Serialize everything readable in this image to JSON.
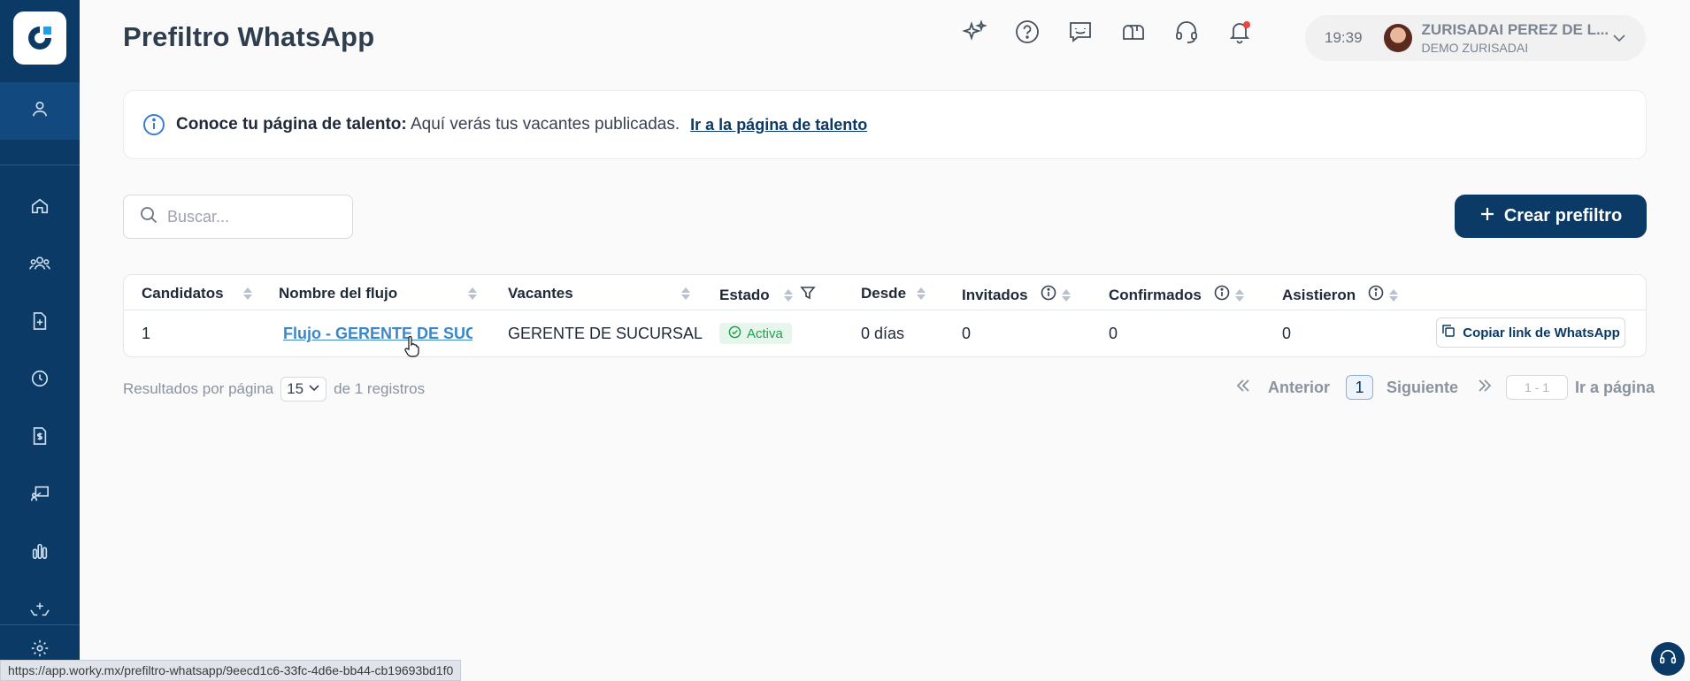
{
  "header": {
    "title": "Prefiltro WhatsApp",
    "icons": [
      "sparkles-icon",
      "help-icon",
      "feedback-icon",
      "mailbox-icon",
      "support-headset-icon",
      "bell-icon"
    ],
    "time": "19:39",
    "user_name": "ZURISADAI PEREZ DE L...",
    "user_org": "DEMO ZURISADAI"
  },
  "sidebar": {
    "items": [
      "user-icon",
      "home-icon",
      "users-icon",
      "add-document-icon",
      "history-icon",
      "invoice-icon",
      "presentation-icon",
      "analytics-icon",
      "hand-care-icon",
      "gear-icon"
    ]
  },
  "banner": {
    "title": "Conoce tu página de talento:",
    "text": " Aquí verás tus vacantes publicadas.",
    "link": "Ir a la página de talento"
  },
  "search": {
    "placeholder": "Buscar..."
  },
  "create_button": {
    "label": "Crear prefiltro"
  },
  "table": {
    "columns": [
      "Candidatos",
      "Nombre del flujo",
      "Vacantes",
      "Estado",
      "Desde",
      "Invitados",
      "Confirmados",
      "Asistieron"
    ],
    "rows": [
      {
        "candidatos": "1",
        "nombre": "Flujo - GERENTE DE SUCURSAL",
        "vacantes": "GERENTE DE SUCURSAL",
        "estado": "Activa",
        "desde": "0 días",
        "invitados": "0",
        "confirmados": "0",
        "asistieron": "0",
        "action": "Copiar link de WhatsApp"
      }
    ]
  },
  "pagination": {
    "per_page_label": "Resultados por página",
    "per_page_value": "15",
    "records_label": "de 1 registros",
    "prev": "Anterior",
    "current": "1",
    "next": "Siguiente",
    "goto_placeholder": "1 - 1",
    "goto_label": "Ir a página"
  },
  "status_url": "https://app.worky.mx/prefiltro-whatsapp/9eecd1c6-33fc-4d6e-bb44-cb19693bd1f0",
  "colors": {
    "primary": "#0b3a66",
    "link": "#3a88c9",
    "active": "#22a04b"
  }
}
